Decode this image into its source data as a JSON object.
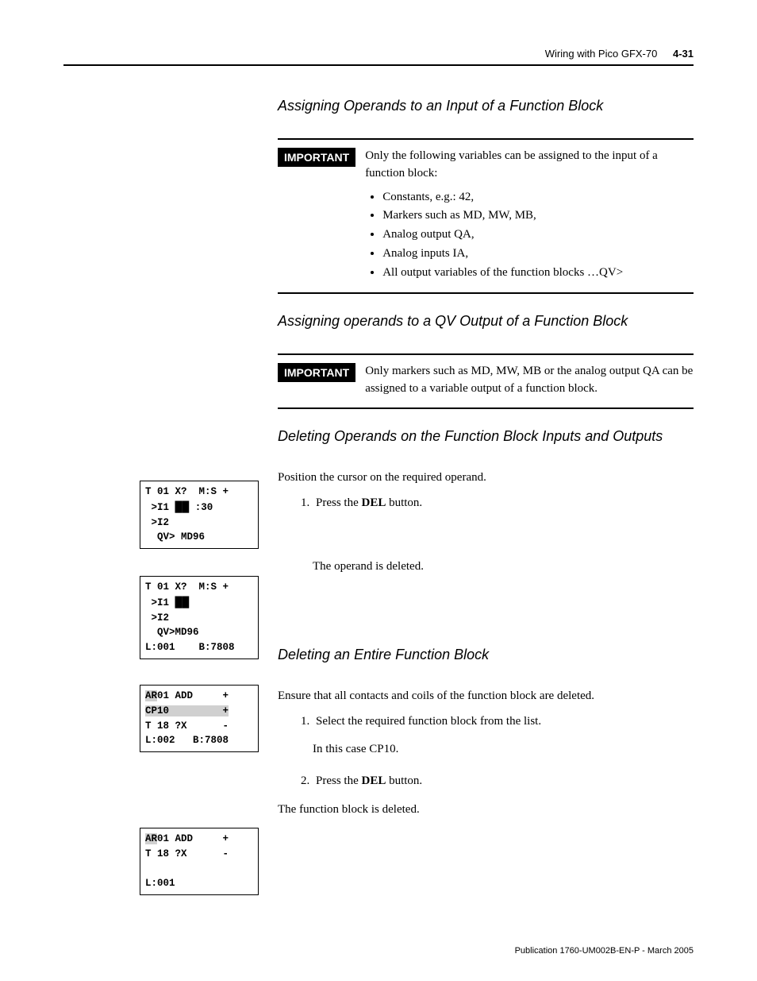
{
  "header": {
    "chapter": "Wiring with Pico GFX-70",
    "pagenum": "4-31"
  },
  "sections": {
    "assign_input": {
      "heading": "Assigning Operands to an Input of a Function Block",
      "important_label": "IMPORTANT",
      "important_intro": "Only the following variables can be assigned to the input of a function block:",
      "bullets": [
        "Constants, e.g.: 42,",
        "Markers such as MD, MW, MB,",
        "Analog output QA,",
        "Analog inputs IA,",
        "All output variables of the function blocks …QV>"
      ]
    },
    "assign_qv": {
      "heading": "Assigning operands to a QV Output of a Function Block",
      "important_label": "IMPORTANT",
      "important_text": "Only markers such as MD, MW, MB or the analog output QA can be assigned to a variable output of a function block."
    },
    "delete_operands": {
      "heading": "Deleting Operands on the Function Block Inputs and Outputs",
      "intro": "Position the cursor on the required operand.",
      "step1_pre": "Press the ",
      "step1_bold": "DEL",
      "step1_post": " button.",
      "result": "The operand is deleted."
    },
    "delete_fb": {
      "heading": "Deleting an Entire Function Block",
      "intro": "Ensure that all contacts and coils of the function block are deleted.",
      "step1": "Select the required function block from the list.",
      "note": "In this case CP10.",
      "step2_pre": "Press the ",
      "step2_bold": "DEL",
      "step2_post": " button.",
      "result": "The function block is deleted."
    }
  },
  "lcd1": {
    "r1": "T 01 X?  M:S +",
    "r2a": " >I1 ",
    "r2b": "██",
    "r2c": " :30",
    "r3": " >I2",
    "r4": "  QV> MD96"
  },
  "lcd2": {
    "r1": "T 01 X?  M:S +",
    "r2a": " >I1 ",
    "r2b": "██",
    "r3": " >I2",
    "r4": "  QV>MD96",
    "r5": "L:001    B:7808"
  },
  "lcd3": {
    "r1a": "AR",
    "r1b": "01 ADD     +",
    "r2": "CP10         +",
    "r3": "T 18 ?X      -",
    "r4": "L:002   B:7808"
  },
  "lcd4": {
    "r1a": "AR",
    "r1b": "01 ADD     +",
    "r2": "T 18 ?X      -",
    "r3": " ",
    "r4": "L:001"
  },
  "footer": "Publication 1760-UM002B-EN-P - March 2005"
}
